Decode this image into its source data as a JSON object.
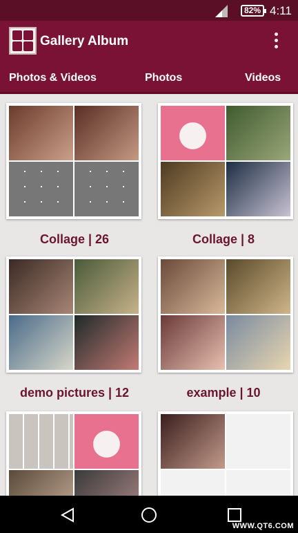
{
  "status_bar": {
    "battery": "82%",
    "time": "4:11"
  },
  "app_bar": {
    "title": "Gallery Album"
  },
  "tabs": [
    {
      "label": "Photos & Videos"
    },
    {
      "label": "Photos"
    },
    {
      "label": "Videos"
    }
  ],
  "albums": [
    {
      "caption": "Collage | 26"
    },
    {
      "caption": "Collage | 8"
    },
    {
      "caption": "demo pictures | 12"
    },
    {
      "caption": "example | 10"
    }
  ],
  "watermark": "WWW.QT6.COM",
  "colors": {
    "status_bar": "#5b0f26",
    "app_bar": "#7a1235",
    "caption": "#6a1631",
    "background": "#e9e6e6"
  }
}
